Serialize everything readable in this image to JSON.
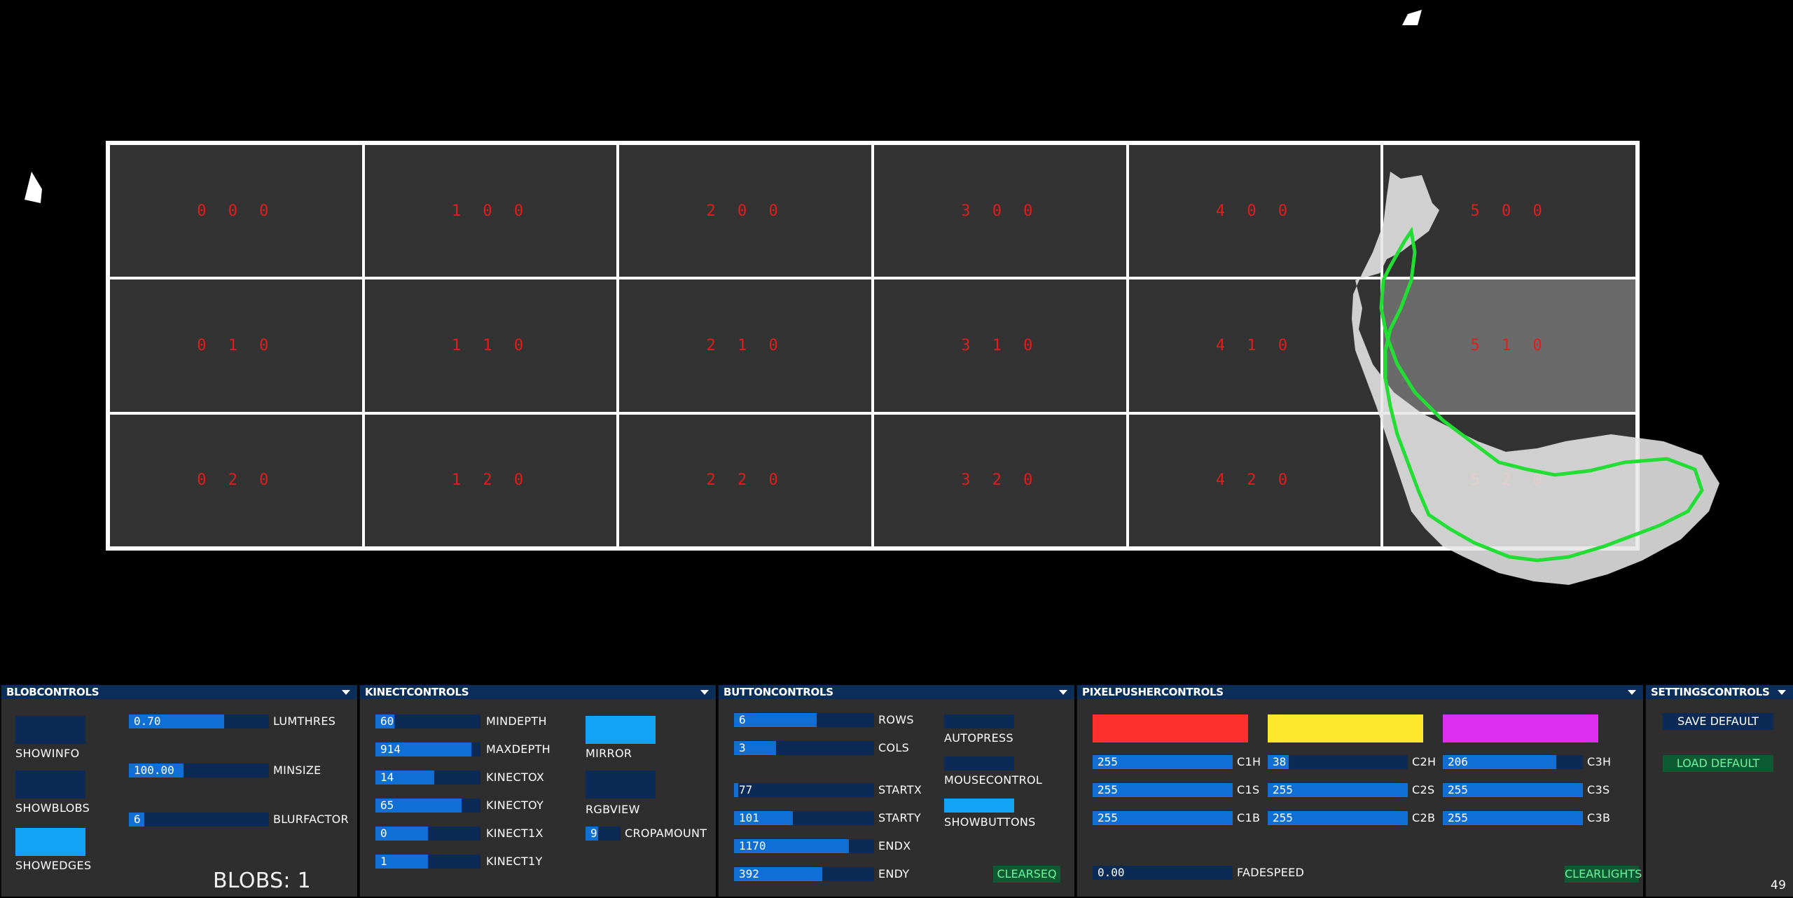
{
  "grid": {
    "rows": [
      [
        "0 0 0",
        "1 0 0",
        "2 0 0",
        "3 0 0",
        "4 0 0",
        "5 0 0"
      ],
      [
        "0 1 0",
        "1 1 0",
        "2 1 0",
        "3 1 0",
        "4 1 0",
        "5 1 0"
      ],
      [
        "0 2 0",
        "1 2 0",
        "2 2 0",
        "3 2 0",
        "4 2 0",
        "5 2 0"
      ]
    ],
    "active_cell": "5 1 0"
  },
  "blob_controls": {
    "title": "BLOBCONTROLS",
    "toggles": [
      {
        "label": "SHOWINFO",
        "on": false
      },
      {
        "label": "SHOWBLOBS",
        "on": false
      },
      {
        "label": "SHOWEDGES",
        "on": true
      }
    ],
    "sliders": [
      {
        "value": "0.70",
        "label": "LUMTHRES",
        "fraction": 0.68
      },
      {
        "value": "100.00",
        "label": "MINSIZE",
        "fraction": 0.39
      },
      {
        "value": "6",
        "label": "BLURFACTOR",
        "fraction": 0.11
      }
    ],
    "blobs_text": "BLOBS: 1"
  },
  "kinect_controls": {
    "title": "KINECTCONTROLS",
    "sliders": [
      {
        "value": "60",
        "label": "MINDEPTH",
        "fraction": 0.18
      },
      {
        "value": "914",
        "label": "MAXDEPTH",
        "fraction": 0.91
      },
      {
        "value": "14",
        "label": "KINECTOX",
        "fraction": 0.56
      },
      {
        "value": "65",
        "label": "KINECTOY",
        "fraction": 0.82
      },
      {
        "value": "0",
        "label": "KINECT1X",
        "fraction": 0.5
      },
      {
        "value": "1",
        "label": "KINECT1Y",
        "fraction": 0.5
      }
    ],
    "toggles": [
      {
        "label": "MIRROR",
        "on": true
      },
      {
        "label": "RGBVIEW",
        "on": false
      }
    ],
    "crop": {
      "value": "9",
      "label": "CROPAMOUNT",
      "fraction": 0.35
    }
  },
  "button_controls": {
    "title": "BUTTONCONTROLS",
    "sliders": [
      {
        "value": "6",
        "label": "ROWS",
        "fraction": 0.59
      },
      {
        "value": "3",
        "label": "COLS",
        "fraction": 0.3
      },
      {
        "value": "77",
        "label": "STARTX",
        "fraction": 0.03
      },
      {
        "value": "101",
        "label": "STARTY",
        "fraction": 0.42
      },
      {
        "value": "1170",
        "label": "ENDX",
        "fraction": 0.82
      },
      {
        "value": "392",
        "label": "ENDY",
        "fraction": 0.63
      }
    ],
    "toggles": [
      {
        "label": "AUTOPRESS",
        "on": false
      },
      {
        "label": "MOUSECONTROL",
        "on": false
      },
      {
        "label": "SHOWBUTTONS",
        "on": true
      }
    ],
    "clear_label": "CLEARSEQ"
  },
  "pixelpusher_controls": {
    "title": "PIXELPUSHERCONTROLS",
    "swatches": [
      "#ff2f2f",
      "#ffe82c",
      "#dc2ff0"
    ],
    "sliders": [
      [
        {
          "value": "255",
          "label": "C1H",
          "fraction": 1.0
        },
        {
          "value": "255",
          "label": "C1S",
          "fraction": 1.0
        },
        {
          "value": "255",
          "label": "C1B",
          "fraction": 1.0
        }
      ],
      [
        {
          "value": "38",
          "label": "C2H",
          "fraction": 0.15
        },
        {
          "value": "255",
          "label": "C2S",
          "fraction": 1.0
        },
        {
          "value": "255",
          "label": "C2B",
          "fraction": 1.0
        }
      ],
      [
        {
          "value": "206",
          "label": "C3H",
          "fraction": 0.81
        },
        {
          "value": "255",
          "label": "C3S",
          "fraction": 1.0
        },
        {
          "value": "255",
          "label": "C3B",
          "fraction": 1.0
        }
      ]
    ],
    "fade": {
      "value": "0.00",
      "label": "FADESPEED",
      "fraction": 0.0
    },
    "clear_label": "CLEARLIGHTS"
  },
  "settings_controls": {
    "title": "SETTINGSCONTROLS",
    "save_label": "SAVE DEFAULT",
    "load_label": "LOAD DEFAULT"
  },
  "fps": "49",
  "colors": {
    "cell": "#333333",
    "cell_active": "#6a6a6a",
    "cell_label": "#e21d1d",
    "slider_bg": "#0b2a55",
    "slider_fill": "#0f6fd4",
    "toggle_on": "#12a3f5",
    "contour": "#22dd33"
  }
}
